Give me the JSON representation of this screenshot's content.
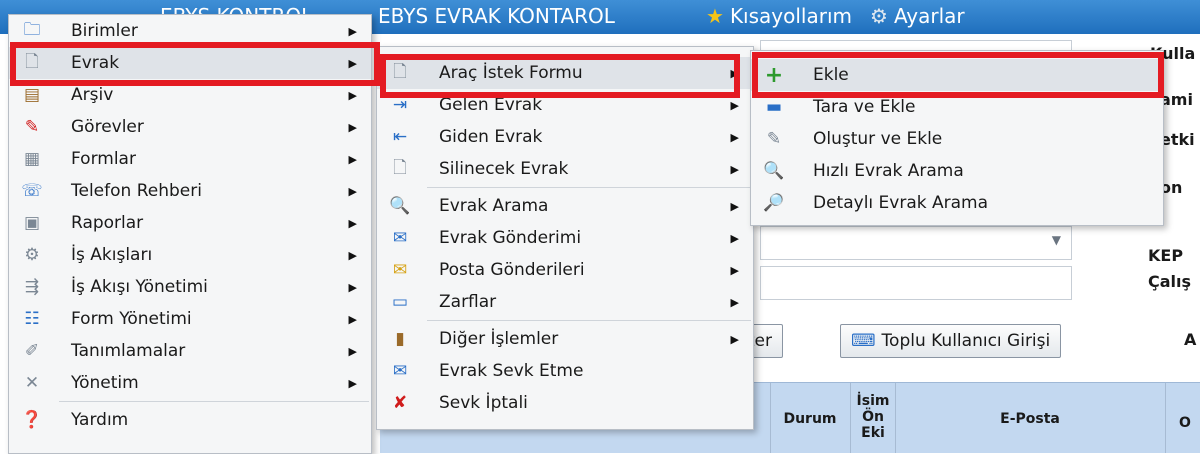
{
  "topbar": {
    "title_left": "EBYS KONTROL",
    "title_main": "EBYS EVRAK KONTAROL",
    "shortcuts": "Kısayollarım",
    "settings": "Ayarlar"
  },
  "background": {
    "labels": [
      "Kulla",
      "ami",
      "etki",
      "on",
      "KEP",
      "Çalış",
      "A",
      "O"
    ],
    "buttons": {
      "list": "ster",
      "bulk_user": "Toplu Kullanıcı Girişi"
    },
    "grid_headers": {
      "durum": "Durum",
      "isim_on_eki": "İsim Ön Eki",
      "eposta": "E-Posta"
    }
  },
  "menu_main": [
    {
      "label": "Birimler",
      "icon": "folder-icon"
    },
    {
      "label": "Evrak",
      "icon": "document-icon"
    },
    {
      "label": "Arşiv",
      "icon": "archive-icon"
    },
    {
      "label": "Görevler",
      "icon": "tasks-icon"
    },
    {
      "label": "Formlar",
      "icon": "forms-icon"
    },
    {
      "label": "Telefon Rehberi",
      "icon": "phonebook-icon"
    },
    {
      "label": "Raporlar",
      "icon": "reports-icon"
    },
    {
      "label": "İş Akışları",
      "icon": "workflow-icon"
    },
    {
      "label": "İş Akışı Yönetimi",
      "icon": "workflow-admin-icon"
    },
    {
      "label": "Form Yönetimi",
      "icon": "form-admin-icon"
    },
    {
      "label": "Tanımlamalar",
      "icon": "definitions-icon"
    },
    {
      "label": "Yönetim",
      "icon": "tools-icon"
    },
    {
      "label": "Yardım",
      "icon": "help-icon"
    }
  ],
  "menu_evrak": [
    {
      "label": "Araç İstek Formu",
      "icon": "document-icon"
    },
    {
      "label": "Gelen Evrak",
      "icon": "incoming-icon"
    },
    {
      "label": "Giden Evrak",
      "icon": "outgoing-icon"
    },
    {
      "label": "Silinecek Evrak",
      "icon": "document-icon"
    },
    {
      "label": "Evrak Arama",
      "icon": "search-icon"
    },
    {
      "label": "Evrak Gönderimi",
      "icon": "send-icon"
    },
    {
      "label": "Posta Gönderileri",
      "icon": "mail-icon"
    },
    {
      "label": "Zarflar",
      "icon": "envelope-icon"
    },
    {
      "label": "Diğer İşlemler",
      "icon": "other-icon"
    },
    {
      "label": "Evrak Sevk Etme",
      "icon": "dispatch-icon"
    },
    {
      "label": "Sevk İptali",
      "icon": "cancel-dispatch-icon"
    }
  ],
  "menu_arac": [
    {
      "label": "Ekle",
      "icon": "plus-icon"
    },
    {
      "label": "Tara ve Ekle",
      "icon": "scanner-icon"
    },
    {
      "label": "Oluştur ve Ekle",
      "icon": "create-icon"
    },
    {
      "label": "Hızlı Evrak Arama",
      "icon": "search-icon"
    },
    {
      "label": "Detaylı Evrak Arama",
      "icon": "user-search-icon"
    }
  ]
}
